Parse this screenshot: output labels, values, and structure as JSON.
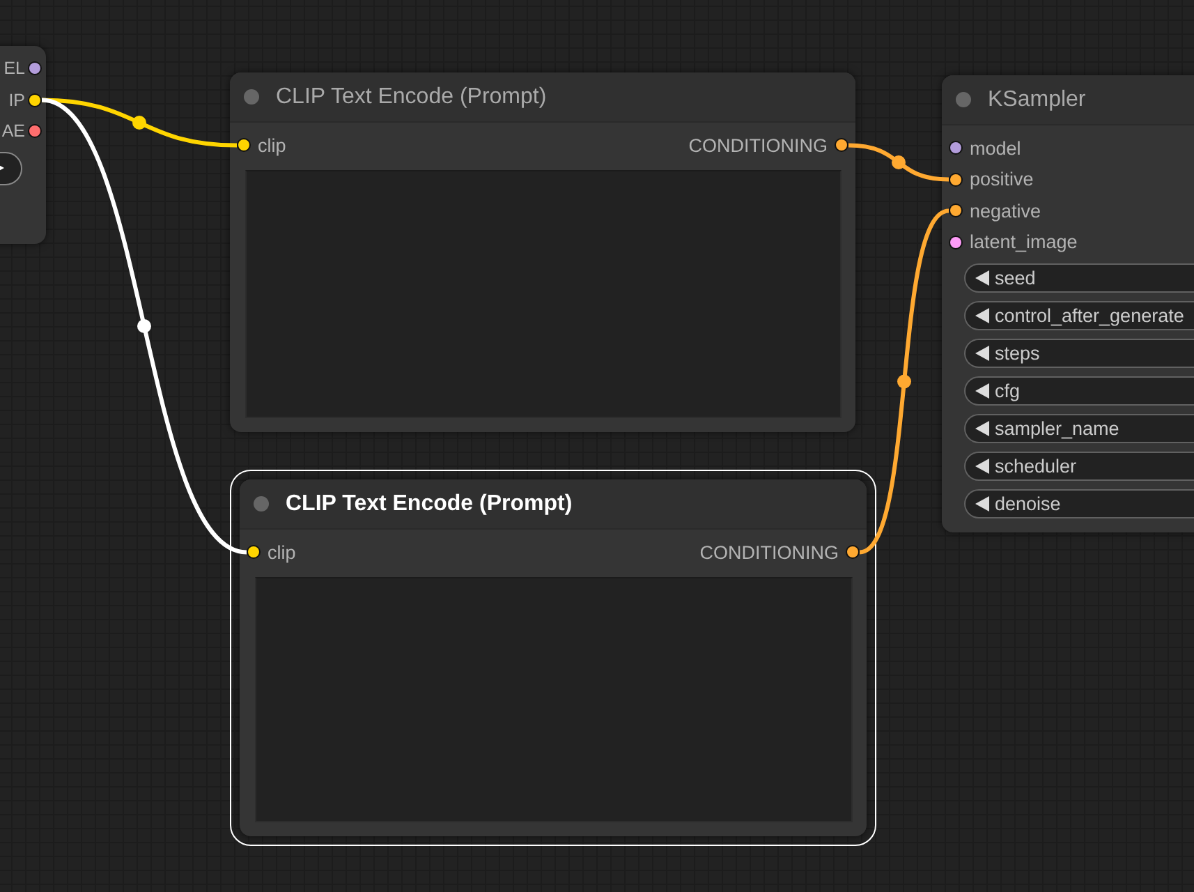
{
  "nodes": [
    {
      "kind": "partial",
      "outputs": [
        {
          "label": "EL",
          "color": "#b39ddb"
        },
        {
          "label": "IP",
          "color": "#ffd500"
        },
        {
          "label": "AE",
          "color": "#ff6e6e"
        }
      ]
    },
    {
      "kind": "text_encode",
      "title": "CLIP Text Encode (Prompt)",
      "selected": false,
      "inputs": [
        {
          "label": "clip",
          "color": "#ffd500"
        }
      ],
      "outputs": [
        {
          "label": "CONDITIONING",
          "color": "#ffa931"
        }
      ]
    },
    {
      "kind": "text_encode",
      "title": "CLIP Text Encode (Prompt)",
      "selected": true,
      "inputs": [
        {
          "label": "clip",
          "color": "#ffd500"
        }
      ],
      "outputs": [
        {
          "label": "CONDITIONING",
          "color": "#ffa931"
        }
      ]
    },
    {
      "kind": "sampler",
      "title": "KSampler",
      "selected": false,
      "inputs": [
        {
          "label": "model",
          "color": "#b39ddb"
        },
        {
          "label": "positive",
          "color": "#ffa931"
        },
        {
          "label": "negative",
          "color": "#ffa931"
        },
        {
          "label": "latent_image",
          "color": "#ff9cf9"
        }
      ],
      "widgets": [
        "seed",
        "control_after_generate",
        "steps",
        "cfg",
        "sampler_name",
        "scheduler",
        "denoise"
      ]
    }
  ],
  "links": [
    {
      "color": "#ffd500"
    },
    {
      "color": "#ffffff"
    },
    {
      "color": "#ffa931"
    },
    {
      "color": "#ffa931"
    }
  ]
}
